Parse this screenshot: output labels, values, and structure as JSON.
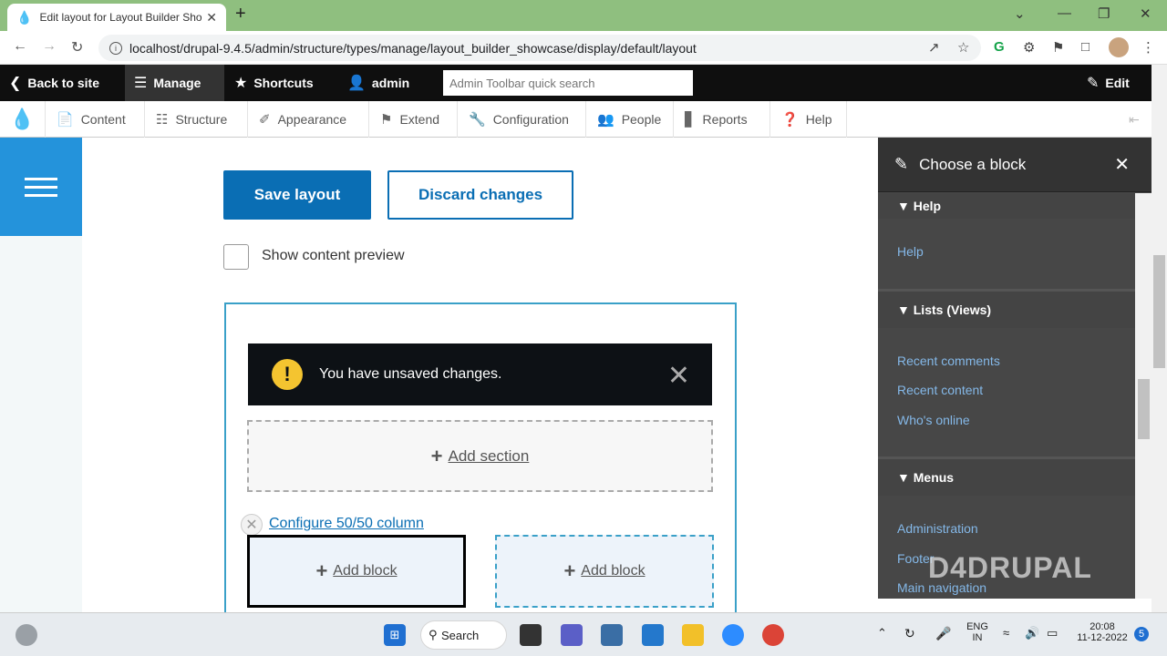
{
  "browser": {
    "tab_title": "Edit layout for Layout Builder Sho",
    "url": "localhost/drupal-9.4.5/admin/structure/types/manage/layout_builder_showcase/display/default/layout"
  },
  "toolbar": {
    "back_to_site": "Back to site",
    "manage": "Manage",
    "shortcuts": "Shortcuts",
    "user": "admin",
    "search_placeholder": "Admin Toolbar quick search",
    "edit": "Edit"
  },
  "tray": {
    "items": [
      {
        "label": "Content",
        "icon": "page-icon"
      },
      {
        "label": "Structure",
        "icon": "structure-icon"
      },
      {
        "label": "Appearance",
        "icon": "brush-icon"
      },
      {
        "label": "Extend",
        "icon": "puzzle-icon"
      },
      {
        "label": "Configuration",
        "icon": "wrench-icon"
      },
      {
        "label": "People",
        "icon": "people-icon"
      },
      {
        "label": "Reports",
        "icon": "bar-chart-icon"
      },
      {
        "label": "Help",
        "icon": "help-icon"
      }
    ]
  },
  "main": {
    "save_button": "Save layout",
    "discard_button": "Discard changes",
    "preview_label": "Show content preview",
    "message": "You have unsaved changes.",
    "add_section": "Add section",
    "configure_link": "Configure 50/50 column",
    "add_block_1": "Add block",
    "add_block_2": "Add block"
  },
  "offcanvas": {
    "title": "Choose a block",
    "groups": [
      {
        "name": "Help",
        "links": [
          "Help"
        ]
      },
      {
        "name": "Lists (Views)",
        "links": [
          "Recent comments",
          "Recent content",
          "Who's online"
        ]
      },
      {
        "name": "Menus",
        "links": [
          "Administration",
          "Footer",
          "Main navigation"
        ]
      }
    ],
    "watermark": "D4DRUPAL"
  },
  "taskbar": {
    "search": "Search",
    "lang_1": "ENG",
    "lang_2": "IN",
    "time": "20:08",
    "date": "11-12-2022",
    "notif_count": "5"
  },
  "colors": {
    "primary": "#0a6eb4",
    "drupal_blue": "#2493db",
    "warning": "#f4c430",
    "link_offcanvas": "#84b8e8"
  }
}
